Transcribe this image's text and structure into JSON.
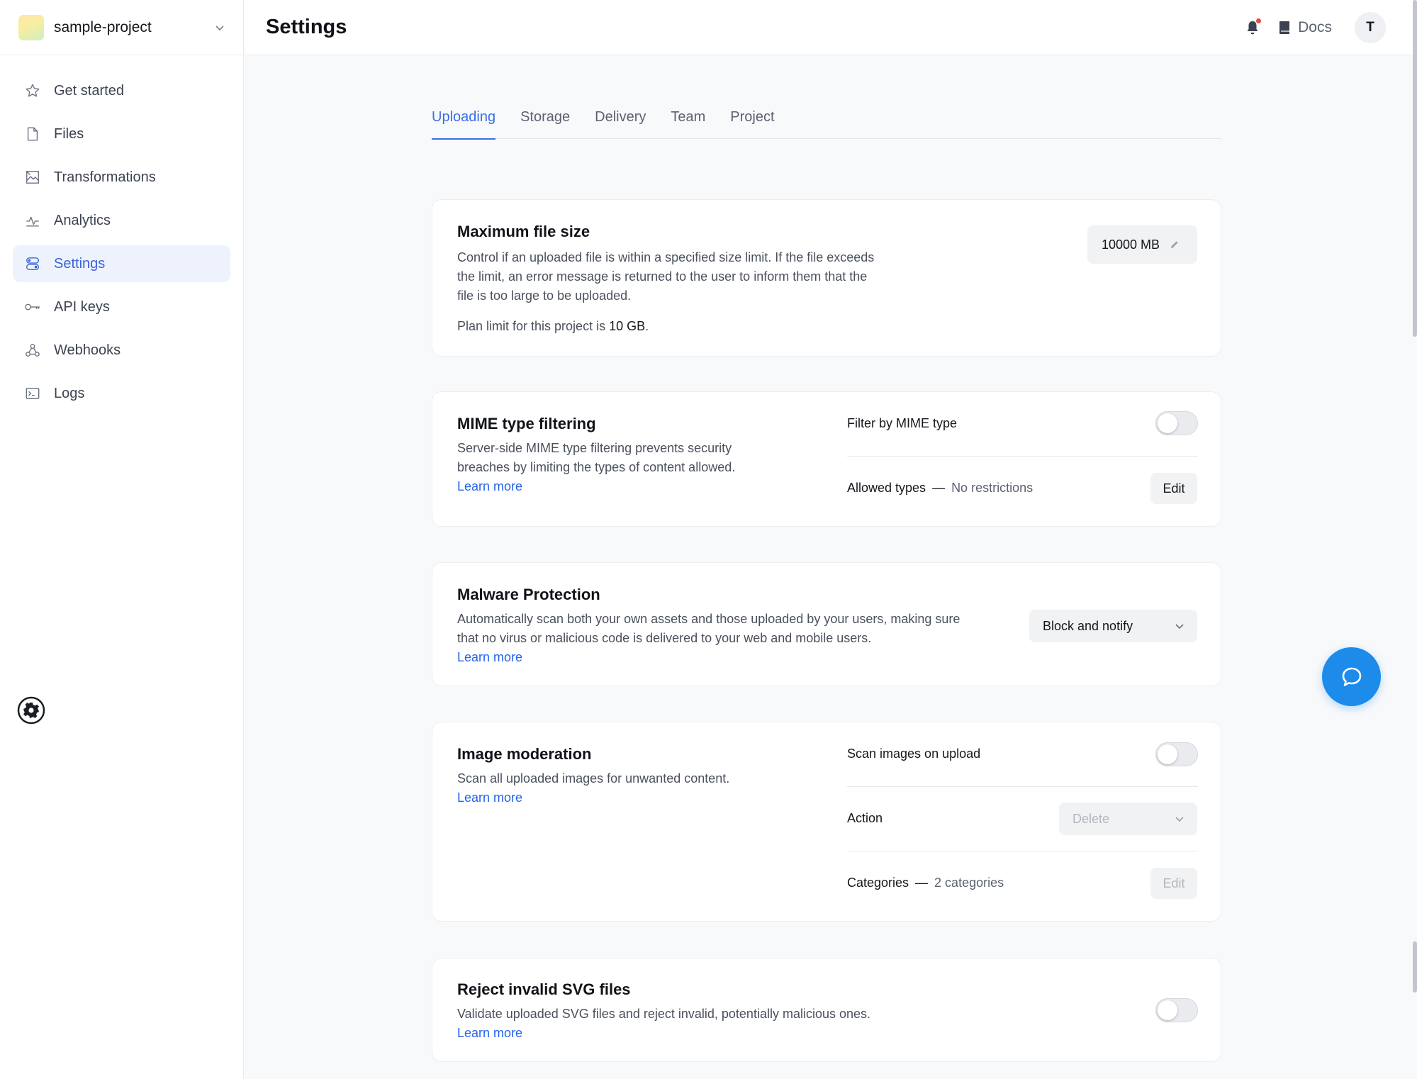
{
  "project": {
    "name": "sample-project"
  },
  "sidebar": {
    "items": [
      {
        "label": "Get started",
        "icon": "star-icon"
      },
      {
        "label": "Files",
        "icon": "file-icon"
      },
      {
        "label": "Transformations",
        "icon": "image-icon"
      },
      {
        "label": "Analytics",
        "icon": "chart-icon"
      },
      {
        "label": "Settings",
        "icon": "settings-toggles-icon",
        "active": true
      },
      {
        "label": "API keys",
        "icon": "key-icon"
      },
      {
        "label": "Webhooks",
        "icon": "webhook-icon"
      },
      {
        "label": "Logs",
        "icon": "terminal-icon"
      }
    ]
  },
  "header": {
    "title": "Settings",
    "docs_label": "Docs",
    "avatar_initial": "T"
  },
  "tabs": [
    {
      "label": "Uploading",
      "active": true
    },
    {
      "label": "Storage"
    },
    {
      "label": "Delivery"
    },
    {
      "label": "Team"
    },
    {
      "label": "Project"
    }
  ],
  "max_file_size": {
    "title": "Maximum file size",
    "desc_line1": "Control if an uploaded file is within a specified size limit. If the file exceeds",
    "desc_line2": "the limit, an error message is returned to the user to inform them that the",
    "desc_line3": "file is too large to be uploaded.",
    "plan_prefix": "Plan limit for this project is ",
    "plan_value": "10 GB",
    "plan_suffix": ".",
    "value": "10000 MB"
  },
  "mime": {
    "title": "MIME type filtering",
    "desc_line1": "Server-side MIME type filtering prevents security",
    "desc_line2": "breaches by limiting the types of content allowed.",
    "learn_more": "Learn more",
    "filter_label": "Filter by MIME type",
    "filter_enabled": false,
    "allowed_label": "Allowed types",
    "dash": "—",
    "allowed_value": "No restrictions",
    "edit_label": "Edit"
  },
  "malware": {
    "title": "Malware Protection",
    "desc_line1": "Automatically scan both your own assets and those uploaded by your users, making sure",
    "desc_line2": "that no virus or malicious code is delivered to your web and mobile users.",
    "learn_more": "Learn more",
    "selected": "Block and notify"
  },
  "moderation": {
    "title": "Image moderation",
    "desc_line1": "Scan all uploaded images for unwanted content.",
    "learn_more": "Learn more",
    "scan_label": "Scan images on upload",
    "scan_enabled": false,
    "action_label": "Action",
    "action_value": "Delete",
    "categories_label": "Categories",
    "dash": "—",
    "categories_value": "2 categories",
    "edit_label": "Edit"
  },
  "svg": {
    "title": "Reject invalid SVG files",
    "desc_line1": "Validate uploaded SVG files and reject invalid, potentially malicious ones.",
    "learn_more": "Learn more",
    "enabled": false
  },
  "colors": {
    "accent": "#3a6ee8",
    "link": "#2563eb",
    "chat": "#1d8bea",
    "active_nav_bg": "#eef2fd"
  }
}
